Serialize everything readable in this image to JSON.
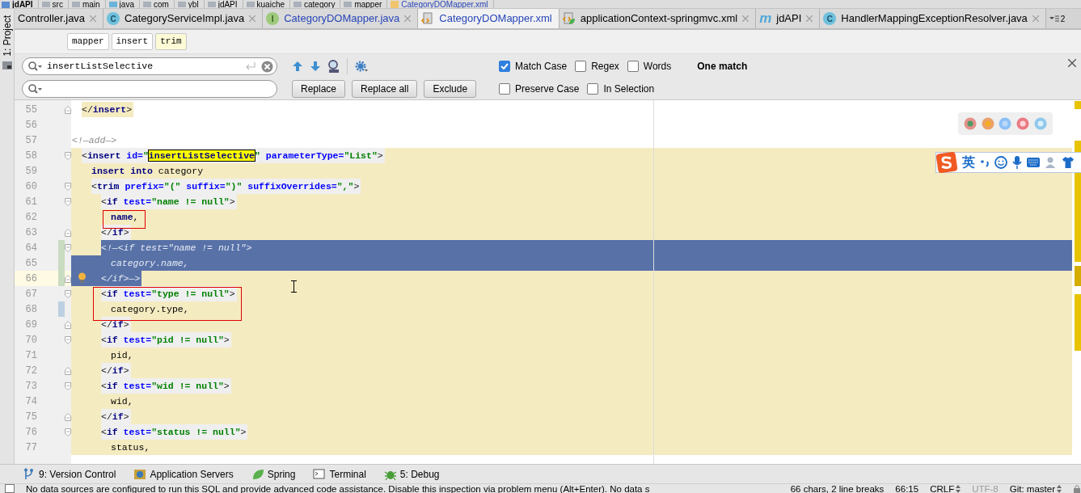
{
  "breadcrumb": [
    {
      "label": "jdAPI",
      "kind": "module"
    },
    {
      "label": "src",
      "kind": "folder"
    },
    {
      "label": "main",
      "kind": "folder"
    },
    {
      "label": "java",
      "kind": "source"
    },
    {
      "label": "com",
      "kind": "folder"
    },
    {
      "label": "ybl",
      "kind": "folder"
    },
    {
      "label": "jdAPI",
      "kind": "folder"
    },
    {
      "label": "kuaiche",
      "kind": "folder"
    },
    {
      "label": "category",
      "kind": "folder"
    },
    {
      "label": "mapper",
      "kind": "folder"
    },
    {
      "label": "CategoryDOMapper.xml",
      "kind": "xml"
    }
  ],
  "side_tab": "1: Project",
  "tabs": [
    {
      "label": "Controller.java",
      "kind": "plain",
      "selected": false,
      "modified": false
    },
    {
      "label": "CategoryServiceImpl.java",
      "kind": "class",
      "icon_text": "C",
      "selected": false,
      "modified": false
    },
    {
      "label": "CategoryDOMapper.java",
      "kind": "interface",
      "icon_text": "I",
      "selected": false,
      "modified": true
    },
    {
      "label": "CategoryDOMapper.xml",
      "kind": "xml",
      "selected": true,
      "modified": true
    },
    {
      "label": "applicationContext-springmvc.xml",
      "kind": "spring",
      "selected": false,
      "modified": false
    },
    {
      "label": "jdAPI",
      "kind": "module",
      "icon_text": "m",
      "selected": false,
      "modified": false
    },
    {
      "label": "HandlerMappingExceptionResolver.java",
      "kind": "class",
      "icon_text": "C",
      "selected": false,
      "modified": false
    }
  ],
  "tab_overflow": "2",
  "xml_path": [
    {
      "label": "mapper",
      "selected": false
    },
    {
      "label": "insert",
      "selected": false
    },
    {
      "label": "trim",
      "selected": true
    }
  ],
  "find": {
    "query": "insertListSelective",
    "buttons": [
      "Replace",
      "Replace all",
      "Exclude"
    ],
    "options": [
      [
        {
          "label": "Match Case",
          "checked": true
        },
        {
          "label": "Regex",
          "checked": false
        },
        {
          "label": "Words",
          "checked": false
        }
      ],
      [
        {
          "label": "Preserve Case",
          "checked": false
        },
        {
          "label": "In Selection",
          "checked": false
        }
      ]
    ],
    "result": "One match"
  },
  "code": {
    "lines": [
      {
        "number": "55",
        "kind": "code",
        "tinted": true,
        "fold_close": true,
        "segments": [
          {
            "kind": "punct",
            "text": "</"
          },
          {
            "kind": "tag",
            "text": "insert"
          },
          {
            "kind": "punct",
            "text": ">"
          }
        ]
      },
      {
        "number": "56",
        "kind": "blank"
      },
      {
        "number": "57",
        "kind": "comment",
        "segments": [
          {
            "kind": "comment",
            "text": "<!—add—>"
          }
        ]
      },
      {
        "number": "58",
        "kind": "code",
        "scope": true,
        "tag_bg": true,
        "fold_open": true,
        "segments": [
          {
            "kind": "punct",
            "text": "<"
          },
          {
            "kind": "tag",
            "text": "insert"
          },
          {
            "kind": "attr",
            "text": " id="
          },
          {
            "kind": "value",
            "text": "\""
          },
          {
            "kind": "match",
            "text": "insertListSelective"
          },
          {
            "kind": "value",
            "text": "\""
          },
          {
            "kind": "attr",
            "text": " parameterType="
          },
          {
            "kind": "value",
            "text": "\"List\""
          },
          {
            "kind": "punct",
            "text": ">"
          }
        ],
        "children": [
          {
            "number": "59",
            "kind": "code",
            "scope": true,
            "segments": [
              {
                "kind": "keyword",
                "text": "insert into"
              },
              {
                "kind": "text",
                "text": " category"
              }
            ]
          },
          {
            "number": "60",
            "kind": "code",
            "scope": true,
            "tag_bg": true,
            "fold_open": true,
            "segments": [
              {
                "kind": "punct",
                "text": "<"
              },
              {
                "kind": "tag",
                "text": "trim"
              },
              {
                "kind": "attr",
                "text": " prefix="
              },
              {
                "kind": "value",
                "text": "\"(\""
              },
              {
                "kind": "attr",
                "text": " suffix="
              },
              {
                "kind": "value",
                "text": "\")\""
              },
              {
                "kind": "attr",
                "text": " suffixOverrides="
              },
              {
                "kind": "value",
                "text": "\",\""
              },
              {
                "kind": "punct",
                "text": ">"
              }
            ],
            "children": [
              {
                "number": "61",
                "kind": "code",
                "scope": true,
                "tag_bg": true,
                "fold_open": true,
                "segments": [
                  {
                    "kind": "punct",
                    "text": "<"
                  },
                  {
                    "kind": "tag",
                    "text": "if"
                  },
                  {
                    "kind": "attr",
                    "text": " test="
                  },
                  {
                    "kind": "value",
                    "text": "\"name != null\""
                  },
                  {
                    "kind": "punct",
                    "text": ">"
                  }
                ],
                "children": [
                  {
                    "number": "62",
                    "kind": "code",
                    "scope": true,
                    "red_box": true,
                    "segments": [
                      {
                        "kind": "keyword",
                        "text": "name"
                      },
                      {
                        "kind": "text",
                        "text": ","
                      }
                    ]
                  }
                ]
              },
              {
                "number": "63",
                "kind": "code",
                "scope": true,
                "tag_bg": true,
                "fold_close": true,
                "segments": [
                  {
                    "kind": "punct",
                    "text": "</"
                  },
                  {
                    "kind": "tag",
                    "text": "if"
                  },
                  {
                    "kind": "punct",
                    "text": ">"
                  }
                ]
              },
              {
                "number": "64",
                "kind": "code",
                "scope": true,
                "selection": {
                  "kind": "to_end"
                },
                "added": true,
                "fold_open": true,
                "segments": [
                  {
                    "kind": "comment",
                    "text": "<!—<if test=\"name != null\">"
                  }
                ],
                "children": [
                  {
                    "number": "65",
                    "kind": "code",
                    "selection": {
                      "kind": "full"
                    },
                    "added": true,
                    "segments": [
                      {
                        "kind": "comment",
                        "text": "category.name,"
                      }
                    ]
                  }
                ]
              },
              {
                "number": "66",
                "kind": "code",
                "scope": true,
                "selection": {
                  "kind": "to_text_end"
                },
                "added": true,
                "fold_close": true,
                "current": true,
                "segments": [
                  {
                    "kind": "comment",
                    "text": "</if>—>"
                  }
                ]
              },
              {
                "number": "67",
                "kind": "code",
                "scope": true,
                "tag_bg": true,
                "fold_open": true,
                "red_box": true,
                "segments": [
                  {
                    "kind": "punct",
                    "text": "<"
                  },
                  {
                    "kind": "tag",
                    "text": "if"
                  },
                  {
                    "kind": "attr",
                    "text": " test="
                  },
                  {
                    "kind": "value",
                    "text": "\"type != null\""
                  },
                  {
                    "kind": "punct",
                    "text": ">"
                  }
                ],
                "children": [
                  {
                    "number": "68",
                    "kind": "code",
                    "scope": true,
                    "modified": true,
                    "red_box": true,
                    "segments": [
                      {
                        "kind": "text",
                        "text": "category.type,"
                      }
                    ]
                  }
                ]
              },
              {
                "number": "69",
                "kind": "code",
                "scope": true,
                "tag_bg": true,
                "fold_close": true,
                "segments": [
                  {
                    "kind": "punct",
                    "text": "</"
                  },
                  {
                    "kind": "tag",
                    "text": "if"
                  },
                  {
                    "kind": "punct",
                    "text": ">"
                  }
                ]
              },
              {
                "number": "70",
                "kind": "code",
                "scope": true,
                "tag_bg": true,
                "fold_open": true,
                "segments": [
                  {
                    "kind": "punct",
                    "text": "<"
                  },
                  {
                    "kind": "tag",
                    "text": "if"
                  },
                  {
                    "kind": "attr",
                    "text": " test="
                  },
                  {
                    "kind": "value",
                    "text": "\"pid != null\""
                  },
                  {
                    "kind": "punct",
                    "text": ">"
                  }
                ],
                "children": [
                  {
                    "number": "71",
                    "kind": "code",
                    "scope": true,
                    "segments": [
                      {
                        "kind": "text",
                        "text": "pid,"
                      }
                    ]
                  }
                ]
              },
              {
                "number": "72",
                "kind": "code",
                "scope": true,
                "tag_bg": true,
                "fold_close": true,
                "segments": [
                  {
                    "kind": "punct",
                    "text": "</"
                  },
                  {
                    "kind": "tag",
                    "text": "if"
                  },
                  {
                    "kind": "punct",
                    "text": ">"
                  }
                ]
              },
              {
                "number": "73",
                "kind": "code",
                "scope": true,
                "tag_bg": true,
                "fold_open": true,
                "segments": [
                  {
                    "kind": "punct",
                    "text": "<"
                  },
                  {
                    "kind": "tag",
                    "text": "if"
                  },
                  {
                    "kind": "attr",
                    "text": " test="
                  },
                  {
                    "kind": "value",
                    "text": "\"wid != null\""
                  },
                  {
                    "kind": "punct",
                    "text": ">"
                  }
                ],
                "children": [
                  {
                    "number": "74",
                    "kind": "code",
                    "scope": true,
                    "segments": [
                      {
                        "kind": "text",
                        "text": "wid,"
                      }
                    ]
                  }
                ]
              },
              {
                "number": "75",
                "kind": "code",
                "scope": true,
                "tag_bg": true,
                "fold_close": true,
                "segments": [
                  {
                    "kind": "punct",
                    "text": "</"
                  },
                  {
                    "kind": "tag",
                    "text": "if"
                  },
                  {
                    "kind": "punct",
                    "text": ">"
                  }
                ]
              },
              {
                "number": "76",
                "kind": "code",
                "scope": true,
                "tag_bg": true,
                "fold_open": true,
                "segments": [
                  {
                    "kind": "punct",
                    "text": "<"
                  },
                  {
                    "kind": "tag",
                    "text": "if"
                  },
                  {
                    "kind": "attr",
                    "text": " test="
                  },
                  {
                    "kind": "value",
                    "text": "\"status != null\""
                  },
                  {
                    "kind": "punct",
                    "text": ">"
                  }
                ],
                "children": [
                  {
                    "number": "77",
                    "kind": "code",
                    "scope": true,
                    "segments": [
                      {
                        "kind": "text",
                        "text": "status,"
                      }
                    ]
                  }
                ]
              }
            ]
          }
        ]
      }
    ]
  },
  "ime": {
    "mode": "英"
  },
  "tool_windows": [
    {
      "label": "9: Version Control",
      "kind": "vcs"
    },
    {
      "label": "Application Servers",
      "kind": "servers"
    },
    {
      "label": "Spring",
      "kind": "spring"
    },
    {
      "label": "Terminal",
      "kind": "terminal"
    },
    {
      "label": "5: Debug",
      "kind": "debug"
    }
  ],
  "status": {
    "message": "No data sources are configured to run this SQL and provide advanced code assistance. Disable this inspection via problem menu (Alt+Enter). No data s",
    "items": [
      {
        "text": "66 chars, 2 line breaks",
        "disabled": false,
        "menu": false
      },
      {
        "text": "66:15",
        "disabled": false,
        "menu": false
      },
      {
        "text": "CRLF",
        "disabled": false,
        "menu": true
      },
      {
        "text": "UTF-8",
        "disabled": true,
        "menu": false
      },
      {
        "text": "Git: master",
        "disabled": false,
        "menu": true
      }
    ]
  }
}
